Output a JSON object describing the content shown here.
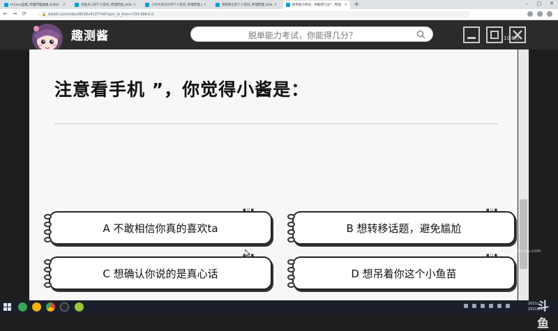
{
  "browser": {
    "tabs": [
      {
        "title": "Hi1ane蓝鹰_哔哩哔哩直播_bilibili",
        "active": false
      },
      {
        "title": "木鱼水心的个人空间_哔哩哔哩_bilibili",
        "active": false
      },
      {
        "title": "小片片说大片的个人空间_哔哩哔哩_bilibili",
        "active": false
      },
      {
        "title": "黑暗骑士的个人空间_哔哩哔哩_bilibili",
        "active": false
      },
      {
        "title": "脱单能力考试，你能得几分？_哔哩",
        "active": true
      }
    ],
    "tab_close_glyph": "×",
    "new_tab_glyph": "+",
    "window_buttons": [
      "–",
      "□",
      "✕"
    ],
    "url": "bilibili.com/video/BV1Ev411T74d?spm_id_from=333.999.0.0"
  },
  "app": {
    "brand": "趣测酱",
    "search_placeholder": "脱单能力考试，你能得几分？",
    "view_count": "10.6万",
    "accent": "#2b2b2b"
  },
  "quiz": {
    "question": "注意看手机 ”，你觉得小酱是：",
    "options": [
      {
        "key": "A",
        "label": "A 不敢相信你真的喜欢ta"
      },
      {
        "key": "B",
        "label": "B 想转移话题，避免尴尬"
      },
      {
        "key": "C",
        "label": "C 想确认你说的是真心话"
      },
      {
        "key": "D",
        "label": "D 想吊着你这个小鱼苗"
      }
    ]
  },
  "taskbar": {
    "clock_time": "2021/",
    "clock_date": "2021/11/"
  },
  "watermark": {
    "brand": "斗鱼",
    "url": "douyu.com"
  },
  "icons": {
    "search": "search-icon",
    "minimize": "minimize-icon",
    "maximize": "maximize-icon",
    "close": "close-icon",
    "start": "windows-start-icon"
  }
}
